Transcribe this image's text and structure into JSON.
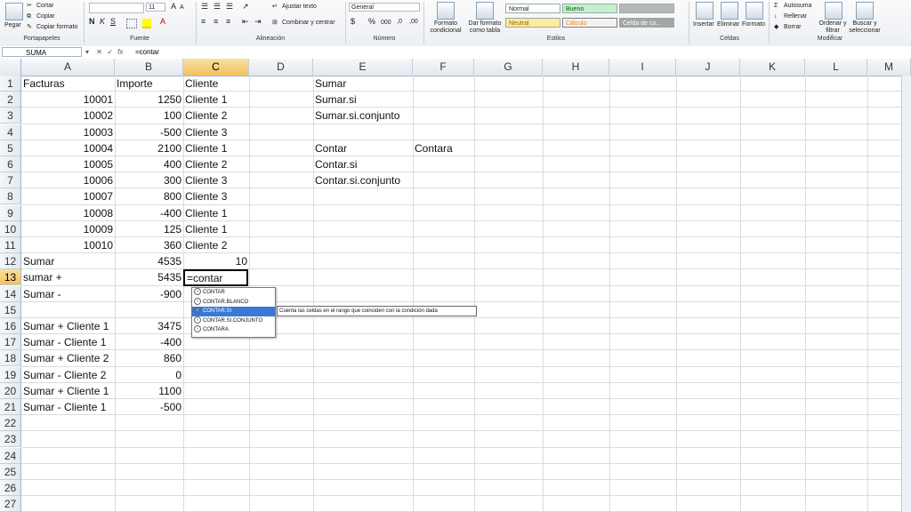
{
  "ribbon": {
    "clipboard": {
      "paste": "Pegar",
      "cut": "Cortar",
      "copy": "Copiar",
      "format_painter": "Copiar formato",
      "label": "Portapapeles"
    },
    "font": {
      "size": "11",
      "label": "Fuente"
    },
    "alignment": {
      "wrap": "Ajustar texto",
      "merge": "Combinar y centrar",
      "label": "Alineación"
    },
    "number": {
      "format": "General",
      "percent": "%",
      "thousands": "000",
      "label": "Número"
    },
    "styles": {
      "conditional": "Formato condicional",
      "as_table": "Dar formato como tabla",
      "normal": "Normal",
      "bueno": "Bueno",
      "neutral": "Neutral",
      "calculo": "Cálculo",
      "celda": "Celda de co...",
      "label": "Estilos"
    },
    "cells": {
      "insert": "Insertar",
      "delete": "Eliminar",
      "format": "Formato",
      "label": "Celdas"
    },
    "editing": {
      "autosum": "Autosuma",
      "fill": "Rellenar",
      "clear": "Borrar",
      "sort": "Ordenar y filtrar",
      "find": "Buscar y seleccionar",
      "label": "Modificar"
    }
  },
  "formula_bar": {
    "name_box": "SUMA",
    "content": "=contar"
  },
  "columns": [
    "A",
    "B",
    "C",
    "D",
    "E",
    "F",
    "G",
    "H",
    "I",
    "J",
    "K",
    "L",
    "M"
  ],
  "rows": [
    "1",
    "2",
    "3",
    "4",
    "5",
    "6",
    "7",
    "8",
    "9",
    "10",
    "11",
    "12",
    "13",
    "14",
    "15",
    "16",
    "17",
    "18",
    "19",
    "20",
    "21",
    "22",
    "23",
    "24",
    "25",
    "26",
    "27"
  ],
  "cells": {
    "a1": "Facturas",
    "b1": "Importe",
    "c1": "Cliente",
    "e1": "Sumar",
    "a2": "10001",
    "b2": "1250",
    "c2": "Cliente 1",
    "e2": "Sumar.si",
    "a3": "10002",
    "b3": "100",
    "c3": "Cliente 2",
    "e3": "Sumar.si.conjunto",
    "a4": "10003",
    "b4": "-500",
    "c4": "Cliente 3",
    "a5": "10004",
    "b5": "2100",
    "c5": "Cliente 1",
    "e5": "Contar",
    "f5": "Contara",
    "a6": "10005",
    "b6": "400",
    "c6": "Cliente 2",
    "e6": "Contar.si",
    "a7": "10006",
    "b7": "300",
    "c7": "Cliente 3",
    "e7": "Contar.si.conjunto",
    "a8": "10007",
    "b8": "800",
    "c8": "Cliente 3",
    "a9": "10008",
    "b9": "-400",
    "c9": "Cliente 1",
    "a10": "10009",
    "b10": "125",
    "c10": "Cliente 1",
    "a11": "10010",
    "b11": "360",
    "c11": "Cliente 2",
    "a12": "Sumar",
    "b12": "4535",
    "c12": "10",
    "a13": "sumar +",
    "b13": "5435",
    "c13": "=contar",
    "a14": "Sumar -",
    "b14": "-900",
    "a16": "Sumar + Cliente 1",
    "b16": "3475",
    "a17": "Sumar - Cliente 1",
    "b17": "-400",
    "a18": "Sumar + Cliente 2",
    "b18": "860",
    "a19": "Sumar - Cliente 2",
    "b19": "0",
    "a20": "Sumar + Cliente 1",
    "b20": "1100",
    "a21": "Sumar - Cliente 1",
    "b21": "-500"
  },
  "autocomplete": {
    "items": [
      "CONTAR",
      "CONTAR.BLANCO",
      "CONTAR.SI",
      "CONTAR.SI.CONJUNTO",
      "CONTARA"
    ],
    "selected_index": 2,
    "tooltip": "Cuenta las celdas en el rango que coinciden con la condición dada"
  },
  "colors": {
    "accent": "#3a78d6",
    "header_selected": "#f1c15f",
    "grid": "#d6dce4"
  }
}
